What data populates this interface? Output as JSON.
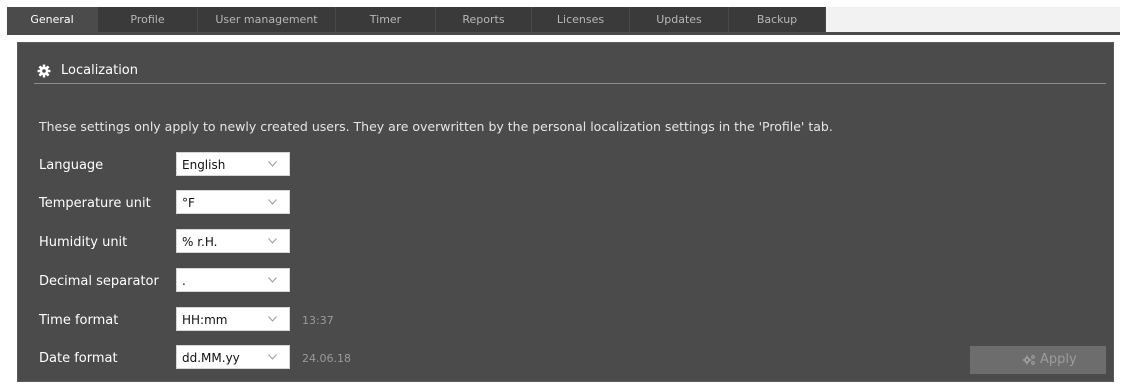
{
  "tabs": [
    {
      "label": "General",
      "active": true
    },
    {
      "label": "Profile",
      "active": false
    },
    {
      "label": "User management",
      "active": false
    },
    {
      "label": "Timer",
      "active": false
    },
    {
      "label": "Reports",
      "active": false
    },
    {
      "label": "Licenses",
      "active": false
    },
    {
      "label": "Updates",
      "active": false
    },
    {
      "label": "Backup",
      "active": false
    }
  ],
  "section": {
    "title": "Localization",
    "icon": "gear-icon",
    "info": "These settings only apply to newly created users. They are overwritten by the personal localization settings in the 'Profile' tab."
  },
  "fields": {
    "language": {
      "label": "Language",
      "value": "English"
    },
    "temperature_unit": {
      "label": "Temperature unit",
      "value": "°F"
    },
    "humidity_unit": {
      "label": "Humidity unit",
      "value": "% r.H."
    },
    "decimal_separator": {
      "label": "Decimal separator",
      "value": "."
    },
    "time_format": {
      "label": "Time format",
      "value": "HH:mm",
      "preview": "13:37"
    },
    "date_format": {
      "label": "Date format",
      "value": "dd.MM.yy",
      "preview": "24.06.18"
    }
  },
  "apply_button": {
    "label": "Apply",
    "icon": "cogs-icon"
  },
  "colors": {
    "tab_active": "#4b4b4b",
    "tab_inactive": "#3a3a3a",
    "panel": "#4b4b4b",
    "apply_disabled": "#6d6d6d"
  }
}
